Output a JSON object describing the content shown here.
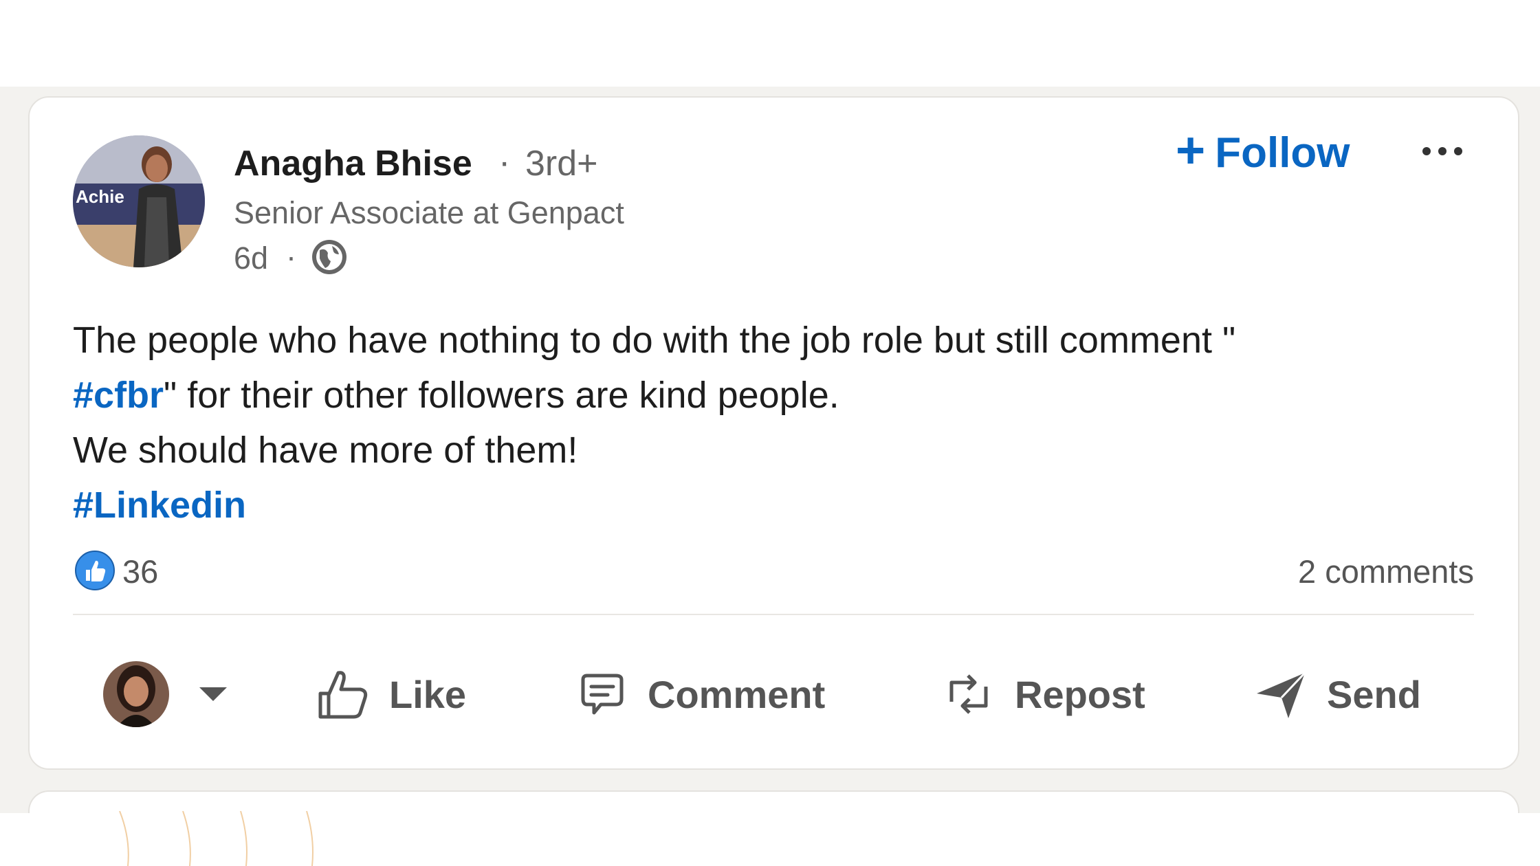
{
  "post": {
    "author": {
      "name": "Anagha Bhise",
      "degree": "3rd+",
      "headline": "Senior Associate at Genpact",
      "time": "6d",
      "avatar_banner_text": "Achie",
      "visibility_icon": "globe-icon"
    },
    "follow_label": "Follow",
    "follow_icon": "plus-icon",
    "more_icon": "ellipsis-icon",
    "body": {
      "line1": "The people who have nothing to do with the job role but still comment \"",
      "hashtag1": "#cfbr",
      "line2_rest": "\" for their other followers are kind people.",
      "line3": "We should have more of them!",
      "hashtag2": "#Linkedin"
    },
    "reactions": {
      "icon": "like-reaction-icon",
      "count": "36"
    },
    "comments_count": "2 comments"
  },
  "actions": {
    "like_label": "Like",
    "comment_label": "Comment",
    "repost_label": "Repost",
    "send_label": "Send"
  },
  "colors": {
    "accent": "#0a66c2",
    "text_primary": "#1d1d1d",
    "text_secondary": "#666666",
    "feed_background": "#f3f2ef"
  }
}
